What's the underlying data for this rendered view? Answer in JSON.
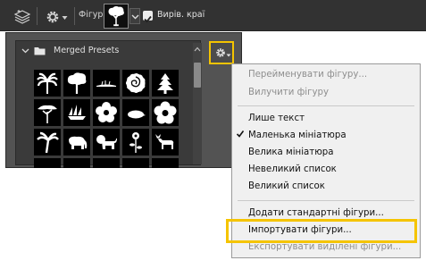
{
  "toolbar": {
    "shape_label": "Фігура:",
    "align_edges_label": "Вирів. краї",
    "align_edges_checked": true,
    "icons": [
      "layers-stack-icon",
      "gear-icon",
      "tree-shape-icon",
      "checkbox-icon"
    ]
  },
  "shape_panel": {
    "preset_folder": "Merged Presets",
    "shapes": [
      "palm-tree-icon",
      "tree-icon",
      "grass-icon",
      "rose-icon",
      "pine-tree-icon",
      "acacia-tree-icon",
      "ship-icon",
      "flower-icon",
      "hedgehog-icon",
      "flower-icon",
      "palm-tree-icon",
      "elephant-icon",
      "lion-icon",
      "flower-stem-icon",
      "moose-icon"
    ]
  },
  "menu": {
    "items": [
      {
        "label": "Перейменувати фігуру...",
        "enabled": false
      },
      {
        "label": "Вилучити фігуру",
        "enabled": false
      },
      {
        "label": "Лише текст",
        "enabled": true
      },
      {
        "label": "Маленька мініатюра",
        "enabled": true,
        "checked": true
      },
      {
        "label": "Велика мініатюра",
        "enabled": true
      },
      {
        "label": "Невеликий список",
        "enabled": true
      },
      {
        "label": "Великий список",
        "enabled": true
      },
      {
        "label": "Додати стандартні фігури...",
        "enabled": true
      },
      {
        "label": "Імпортувати фігури...",
        "enabled": true,
        "highlighted": true
      },
      {
        "label": "Експортувати виділені фігури...",
        "enabled": false
      }
    ]
  },
  "colors": {
    "highlight": "#f5c400",
    "toolbar_bg": "#323232",
    "panel_bg": "#535353",
    "menu_bg": "#f0f0f0"
  }
}
